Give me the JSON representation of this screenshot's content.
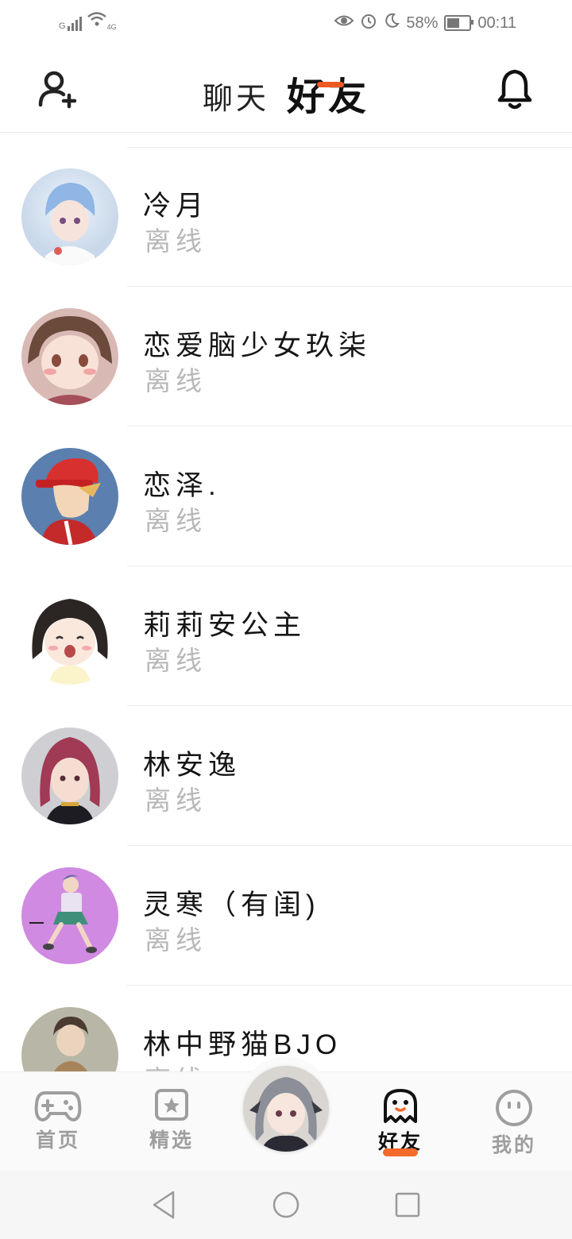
{
  "status_bar": {
    "network": "G",
    "wifi_badge": "4G",
    "battery_percent": "58%",
    "battery_level": 0.58,
    "time": "00:11"
  },
  "header": {
    "tab_chat": "聊天",
    "tab_friends": "好友",
    "active_tab": "好友"
  },
  "friends": [
    {
      "name": "冷月",
      "status": "离线"
    },
    {
      "name": "恋爱脑少女玖柒",
      "status": "离线"
    },
    {
      "name": "恋泽.",
      "status": "离线"
    },
    {
      "name": "莉莉安公主",
      "status": "离线"
    },
    {
      "name": "林安逸",
      "status": "离线"
    },
    {
      "name": "灵寒（有闺)",
      "status": "离线"
    },
    {
      "name": "林中野猫BJO",
      "status": "离线"
    }
  ],
  "bottom_nav": {
    "home": "首页",
    "featured": "精选",
    "friends": "好友",
    "mine": "我的",
    "active": "好友"
  },
  "colors": {
    "accent": "#ee5a24",
    "offline_text": "#b8b8b8",
    "inactive_nav": "#9e9e9e"
  }
}
